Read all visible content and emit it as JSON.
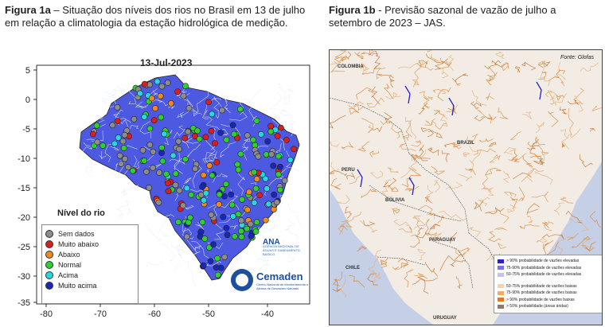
{
  "caption_a": {
    "label": "Figura 1a",
    "text": " – Situação dos níveis dos rios no Brasil em 13 de julho em relação a climatologia da estação hidrológica de medição."
  },
  "caption_b": {
    "label": "Figura 1b",
    "text": " -  Previsão sazonal de vazão de julho a setembro de 2023 – JAS."
  },
  "map_a": {
    "date": "13-Jul-2023",
    "y_ticks": [
      "5",
      "0",
      "-5",
      "-10",
      "-15",
      "-20",
      "-25",
      "-30",
      "-35"
    ],
    "x_ticks": [
      "-80",
      "-70",
      "-60",
      "-50",
      "-40"
    ],
    "legend_title": "Nível do rio",
    "legend": [
      {
        "label": "Sem dados",
        "color": "#8c8c8c"
      },
      {
        "label": "Muito abaixo",
        "color": "#d81e1e"
      },
      {
        "label": "Abaixo",
        "color": "#f08a1c"
      },
      {
        "label": "Normal",
        "color": "#2fcf2f"
      },
      {
        "label": "Acima",
        "color": "#29d6e6"
      },
      {
        "label": "Muito acima",
        "color": "#1828b4"
      }
    ],
    "ana_logo": {
      "name": "ANA",
      "sub": "AGÊNCIA NACIONAL DE ÁGUAS E SANEAMENTO BÁSICO"
    },
    "cemaden_logo": {
      "name": "Cemaden",
      "sub": "Centro Nacional de Monitoramento e Alertas de Desastres Naturais"
    }
  },
  "map_b": {
    "source": "Fonte: Glofas",
    "countries": [
      "COLOMBIA",
      "PERU",
      "BRAZIL",
      "BOLIVIA",
      "PARAGUAY",
      "CHILE",
      "URUGUAY"
    ],
    "legend": [
      {
        "label": "> 90% probabilidade de vazões elevadas",
        "color": "#2a1fc9"
      },
      {
        "label": "75-90% probabilidade de vazões elevadas",
        "color": "#7b74e0"
      },
      {
        "label": "50-75% probabilidade de vazões elevadas",
        "color": "#c4c0f0"
      },
      {
        "label": "50-75% probabilidade de vazões baixas",
        "color": "#f6d3b0"
      },
      {
        "label": "75-90% probabilidade de vazões baixas",
        "color": "#f0aa6a"
      },
      {
        "label": "> 90% probabilidade de vazões baixas",
        "color": "#e07a1a"
      },
      {
        "label": "> 50% probabilidade (áreas áridas)",
        "color": "#8a7a6a"
      }
    ]
  }
}
